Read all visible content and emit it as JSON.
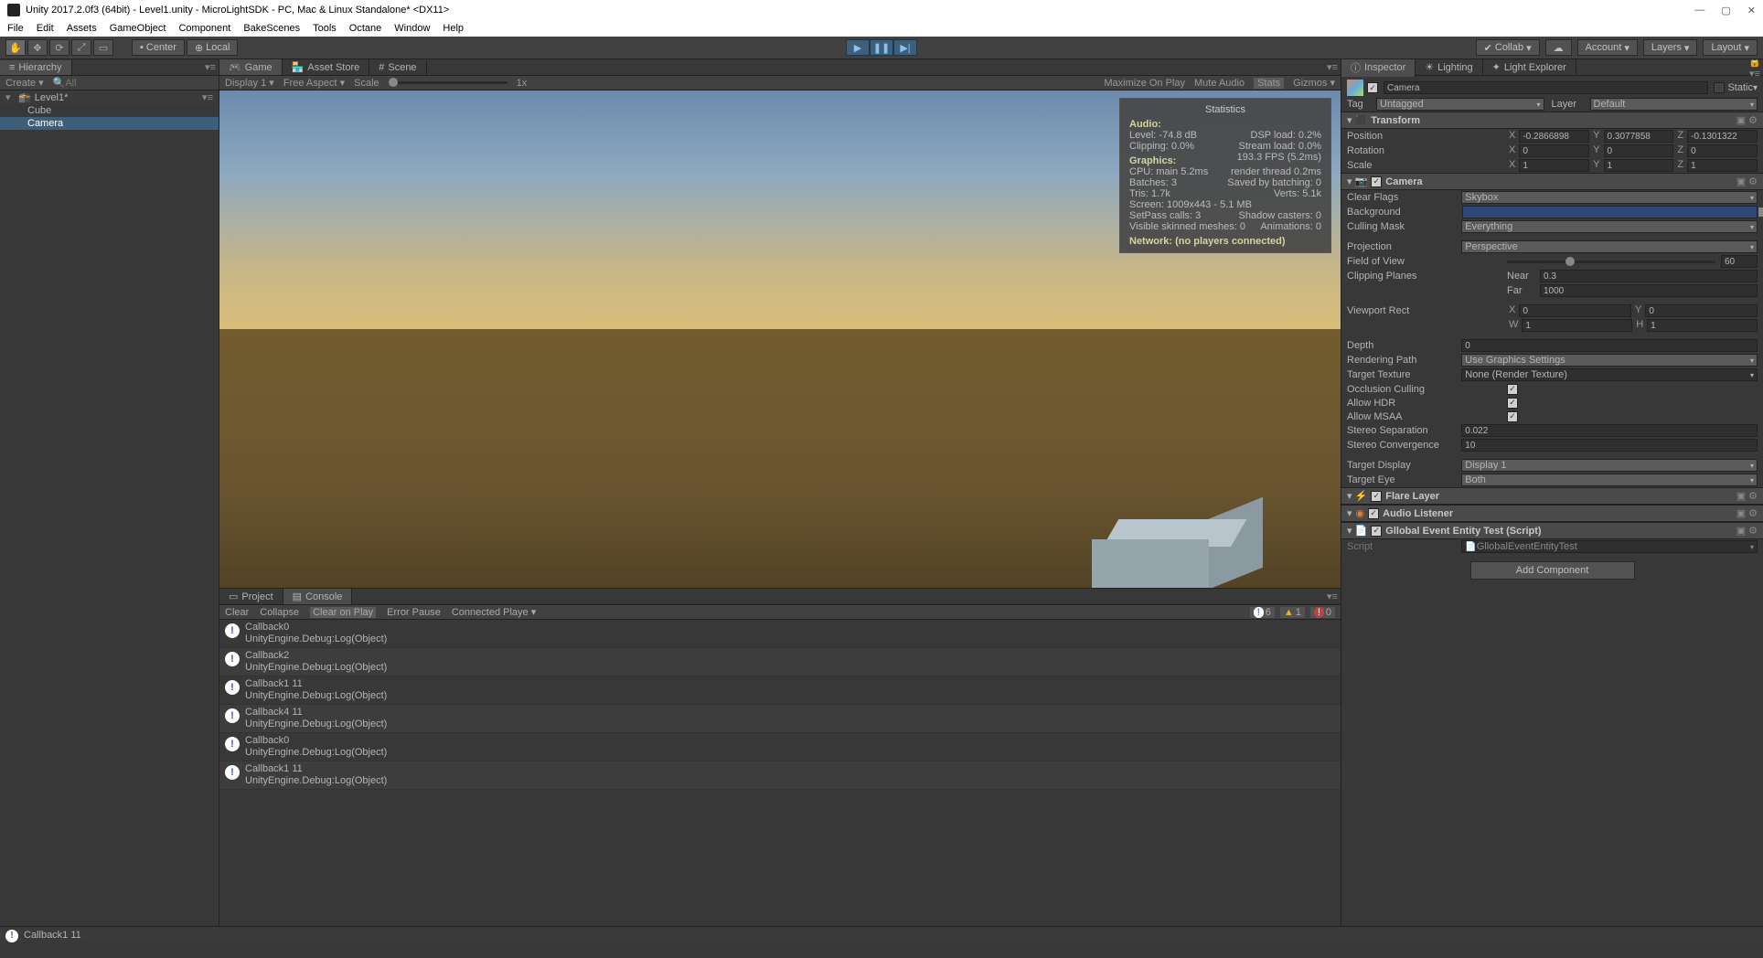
{
  "window": {
    "title": "Unity 2017.2.0f3 (64bit) - Level1.unity - MicroLightSDK - PC, Mac & Linux Standalone* <DX11>"
  },
  "menubar": [
    "File",
    "Edit",
    "Assets",
    "GameObject",
    "Component",
    "BakeScenes",
    "Tools",
    "Octane",
    "Window",
    "Help"
  ],
  "toolbar": {
    "pivot_center": "Center",
    "pivot_local": "Local",
    "collab": "Collab",
    "account": "Account",
    "layers": "Layers",
    "layout": "Layout"
  },
  "hierarchy": {
    "title": "Hierarchy",
    "create": "Create",
    "search_placeholder": "All",
    "scene": "Level1*",
    "items": [
      "Cube",
      "Camera"
    ],
    "selected_index": 1
  },
  "center_tabs": [
    "Game",
    "Asset Store",
    "Scene"
  ],
  "game_bar": {
    "display": "Display 1",
    "aspect": "Free Aspect",
    "scale_label": "Scale",
    "scale_val": "1x",
    "maximize": "Maximize On Play",
    "mute": "Mute Audio",
    "stats": "Stats",
    "gizmos": "Gizmos"
  },
  "stats": {
    "title": "Statistics",
    "audio_h": "Audio:",
    "audio": [
      [
        "Level: -74.8 dB",
        "DSP load: 0.2%"
      ],
      [
        "Clipping: 0.0%",
        "Stream load: 0.0%"
      ]
    ],
    "graphics_h": "Graphics:",
    "fps": "193.3 FPS (5.2ms)",
    "glines": [
      [
        "CPU: main 5.2ms",
        "render thread 0.2ms"
      ],
      [
        "Batches: 3",
        "Saved by batching: 0"
      ],
      [
        "Tris: 1.7k",
        "Verts: 5.1k"
      ],
      [
        "Screen: 1009x443 - 5.1 MB",
        ""
      ],
      [
        "SetPass calls: 3",
        "Shadow casters: 0"
      ],
      [
        "Visible skinned meshes: 0",
        "Animations: 0"
      ]
    ],
    "network": "Network: (no players connected)"
  },
  "bottom_tabs": [
    "Project",
    "Console"
  ],
  "console": {
    "btns": [
      "Clear",
      "Collapse",
      "Clear on Play",
      "Error Pause",
      "Connected Playe"
    ],
    "counts": {
      "info": "6",
      "warn": "1",
      "err": "0"
    },
    "items": [
      {
        "msg": "Callback0",
        "src": "UnityEngine.Debug:Log(Object)"
      },
      {
        "msg": "Callback2",
        "src": "UnityEngine.Debug:Log(Object)"
      },
      {
        "msg": "Callback1 11",
        "src": "UnityEngine.Debug:Log(Object)"
      },
      {
        "msg": "Callback4 11",
        "src": "UnityEngine.Debug:Log(Object)"
      },
      {
        "msg": "Callback0",
        "src": "UnityEngine.Debug:Log(Object)"
      },
      {
        "msg": "Callback1 11",
        "src": "UnityEngine.Debug:Log(Object)"
      }
    ]
  },
  "statusbar": "Callback1 11",
  "inspector": {
    "tabs": [
      "Inspector",
      "Lighting",
      "Light Explorer"
    ],
    "obj_name": "Camera",
    "static": "Static",
    "tag_label": "Tag",
    "tag": "Untagged",
    "layer_label": "Layer",
    "layer": "Default",
    "transform": {
      "title": "Transform",
      "pos_l": "Position",
      "px": "-0.2866898",
      "py": "0.3077858",
      "pz": "-0.1301322",
      "rot_l": "Rotation",
      "rx": "0",
      "ry": "0",
      "rz": "0",
      "scl_l": "Scale",
      "sx": "1",
      "sy": "1",
      "sz": "1"
    },
    "camera": {
      "title": "Camera",
      "clear_flags_l": "Clear Flags",
      "clear_flags": "Skybox",
      "bg_l": "Background",
      "bg_color": "#304878",
      "cull_l": "Culling Mask",
      "cull": "Everything",
      "proj_l": "Projection",
      "proj": "Perspective",
      "fov_l": "Field of View",
      "fov": "60",
      "clip_l": "Clipping Planes",
      "near_l": "Near",
      "near": "0.3",
      "far_l": "Far",
      "far": "1000",
      "vrect_l": "Viewport Rect",
      "vx": "0",
      "vy": "0",
      "vw": "1",
      "vh": "1",
      "depth_l": "Depth",
      "depth": "0",
      "rpath_l": "Rendering Path",
      "rpath": "Use Graphics Settings",
      "ttex_l": "Target Texture",
      "ttex": "None (Render Texture)",
      "occ_l": "Occlusion Culling",
      "hdr_l": "Allow HDR",
      "msaa_l": "Allow MSAA",
      "ssep_l": "Stereo Separation",
      "ssep": "0.022",
      "sconv_l": "Stereo Convergence",
      "sconv": "10",
      "tdisp_l": "Target Display",
      "tdisp": "Display 1",
      "teye_l": "Target Eye",
      "teye": "Both"
    },
    "flare": "Flare Layer",
    "audio_listener": "Audio Listener",
    "script_comp": {
      "title": "Gllobal Event Entity Test (Script)",
      "script_l": "Script",
      "script": "GllobalEventEntityTest"
    },
    "add_comp": "Add Component"
  }
}
